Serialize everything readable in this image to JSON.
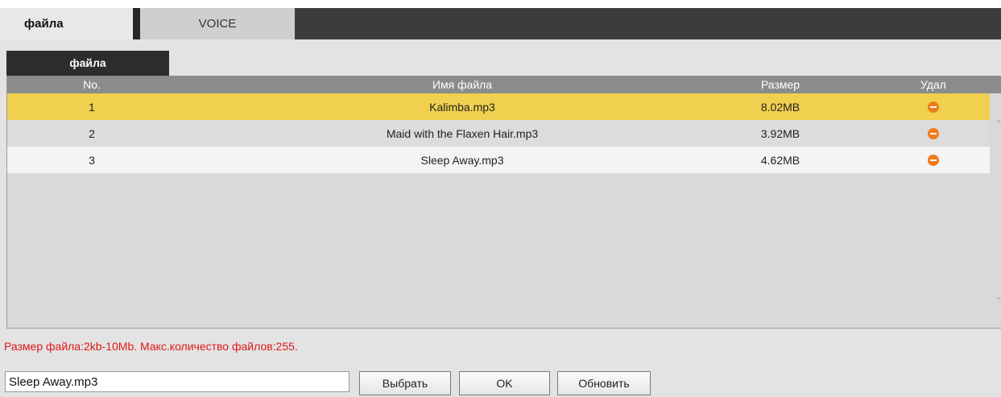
{
  "tabs": [
    {
      "label": "файла"
    },
    {
      "label": "VOICE"
    }
  ],
  "subtab": {
    "label": "файла"
  },
  "table": {
    "headers": {
      "no": "No.",
      "name": "Имя файла",
      "size": "Размер",
      "delete": "Удал"
    },
    "rows": [
      {
        "no": "1",
        "name": "Kalimba.mp3",
        "size": "8.02MB",
        "delete_icon": "delete-icon"
      },
      {
        "no": "2",
        "name": "Maid with the Flaxen Hair.mp3",
        "size": "3.92MB",
        "delete_icon": "delete-icon"
      },
      {
        "no": "3",
        "name": "Sleep Away.mp3",
        "size": "4.62MB",
        "delete_icon": "delete-icon"
      }
    ],
    "selected_row": 1
  },
  "limit_note": "Размер файла:2kb-10Mb. Макс.количество файлов:255.",
  "file_input": {
    "value": "Sleep Away.mp3"
  },
  "buttons": {
    "select": "Выбрать",
    "ok": "OK",
    "refresh": "Обновить"
  },
  "colors": {
    "selected_row": "#f1cf4f",
    "delete_icon": "#f07c1a",
    "limit_note": "#e01818",
    "tab_bar": "#3c3c3c"
  }
}
